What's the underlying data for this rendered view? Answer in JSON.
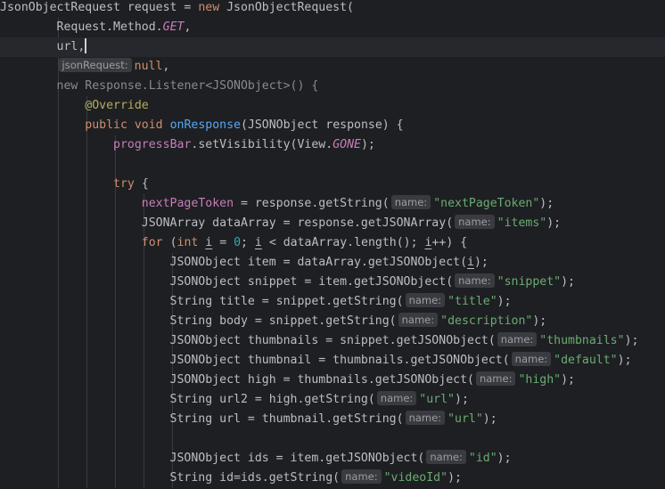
{
  "editor": {
    "language": "java",
    "current_line": 3,
    "colors": {
      "background": "#1e1f22",
      "current_line": "#26282e",
      "text": "#bcbec4",
      "keyword": "#cf8e6d",
      "string": "#6aab73",
      "number": "#2aacb8",
      "field": "#c77dbb",
      "method_declaration": "#56a8f5",
      "annotation": "#b3ae60",
      "hint_background": "#393b40"
    },
    "lines": [
      {
        "segments": [
          {
            "t": "JsonObjectRequest request = "
          },
          {
            "t": "new",
            "c": "kw"
          },
          {
            "t": " JsonObjectRequest("
          }
        ]
      },
      {
        "segments": [
          {
            "t": "        Request.Method."
          },
          {
            "t": "GET",
            "c": "stat"
          },
          {
            "t": ","
          }
        ]
      },
      {
        "segments": [
          {
            "t": "        url,"
          },
          {
            "caret": true
          }
        ]
      },
      {
        "segments": [
          {
            "t": "        "
          },
          {
            "hint": "jsonRequest:"
          },
          {
            "t": "null",
            "c": "kw"
          },
          {
            "t": ","
          }
        ]
      },
      {
        "segments": [
          {
            "t": "        "
          },
          {
            "t": "new Response.Listener<JSONObject>() {",
            "c": "dim"
          }
        ]
      },
      {
        "segments": [
          {
            "t": "            "
          },
          {
            "t": "@Override",
            "c": "ann"
          }
        ]
      },
      {
        "segments": [
          {
            "t": "            "
          },
          {
            "t": "public void",
            "c": "kw"
          },
          {
            "t": " "
          },
          {
            "t": "onResponse",
            "c": "fn"
          },
          {
            "t": "(JSONObject response) {"
          }
        ]
      },
      {
        "segments": [
          {
            "t": "                "
          },
          {
            "t": "progressBar",
            "c": "field"
          },
          {
            "t": ".setVisibility(View."
          },
          {
            "t": "GONE",
            "c": "stat"
          },
          {
            "t": ");"
          }
        ]
      },
      {
        "segments": []
      },
      {
        "segments": [
          {
            "t": "                "
          },
          {
            "t": "try",
            "c": "kw"
          },
          {
            "t": " {"
          }
        ]
      },
      {
        "segments": [
          {
            "t": "                    "
          },
          {
            "t": "nextPageToken",
            "c": "field"
          },
          {
            "t": " = response.getString("
          },
          {
            "hint": "name:"
          },
          {
            "t": "\"nextPageToken\"",
            "c": "str"
          },
          {
            "t": ");"
          }
        ]
      },
      {
        "segments": [
          {
            "t": "                    JSONArray dataArray = response.getJSONArray("
          },
          {
            "hint": "name:"
          },
          {
            "t": "\"items\"",
            "c": "str"
          },
          {
            "t": ");"
          }
        ]
      },
      {
        "segments": [
          {
            "t": "                    "
          },
          {
            "t": "for",
            "c": "kw"
          },
          {
            "t": " ("
          },
          {
            "t": "int",
            "c": "kw"
          },
          {
            "t": " "
          },
          {
            "t": "i",
            "c": "uv"
          },
          {
            "t": " = "
          },
          {
            "t": "0",
            "c": "num"
          },
          {
            "t": "; "
          },
          {
            "t": "i",
            "c": "uv"
          },
          {
            "t": " < dataArray.length(); "
          },
          {
            "t": "i",
            "c": "uv"
          },
          {
            "t": "++) {"
          }
        ]
      },
      {
        "segments": [
          {
            "t": "                        JSONObject item = dataArray.getJSONObject("
          },
          {
            "t": "i",
            "c": "uv"
          },
          {
            "t": ");"
          }
        ]
      },
      {
        "segments": [
          {
            "t": "                        JSONObject snippet = item.getJSONObject("
          },
          {
            "hint": "name:"
          },
          {
            "t": "\"snippet\"",
            "c": "str"
          },
          {
            "t": ");"
          }
        ]
      },
      {
        "segments": [
          {
            "t": "                        String title = snippet.getString("
          },
          {
            "hint": "name:"
          },
          {
            "t": "\"title\"",
            "c": "str"
          },
          {
            "t": ");"
          }
        ]
      },
      {
        "segments": [
          {
            "t": "                        String body = snippet.getString("
          },
          {
            "hint": "name:"
          },
          {
            "t": "\"description\"",
            "c": "str"
          },
          {
            "t": ");"
          }
        ]
      },
      {
        "segments": [
          {
            "t": "                        JSONObject thumbnails = snippet.getJSONObject("
          },
          {
            "hint": "name:"
          },
          {
            "t": "\"thumbnails\"",
            "c": "str"
          },
          {
            "t": ");"
          }
        ]
      },
      {
        "segments": [
          {
            "t": "                        JSONObject thumbnail = thumbnails.getJSONObject("
          },
          {
            "hint": "name:"
          },
          {
            "t": "\"default\"",
            "c": "str"
          },
          {
            "t": ");"
          }
        ]
      },
      {
        "segments": [
          {
            "t": "                        JSONObject high = thumbnails.getJSONObject("
          },
          {
            "hint": "name:"
          },
          {
            "t": "\"high\"",
            "c": "str"
          },
          {
            "t": ");"
          }
        ]
      },
      {
        "segments": [
          {
            "t": "                        String url2 = high.getString("
          },
          {
            "hint": "name:"
          },
          {
            "t": "\"url\"",
            "c": "str"
          },
          {
            "t": ");"
          }
        ]
      },
      {
        "segments": [
          {
            "t": "                        String url = thumbnail.getString("
          },
          {
            "hint": "name:"
          },
          {
            "t": "\"url\"",
            "c": "str"
          },
          {
            "t": ");"
          }
        ]
      },
      {
        "segments": []
      },
      {
        "segments": [
          {
            "t": "                        JSONObject ids = item.getJSONObject("
          },
          {
            "hint": "name:"
          },
          {
            "t": "\"id\"",
            "c": "str"
          },
          {
            "t": ");"
          }
        ]
      },
      {
        "segments": [
          {
            "t": "                        String id=ids.getString("
          },
          {
            "hint": "name:"
          },
          {
            "t": "\"videoId\"",
            "c": "str"
          },
          {
            "t": ");"
          }
        ]
      }
    ]
  }
}
